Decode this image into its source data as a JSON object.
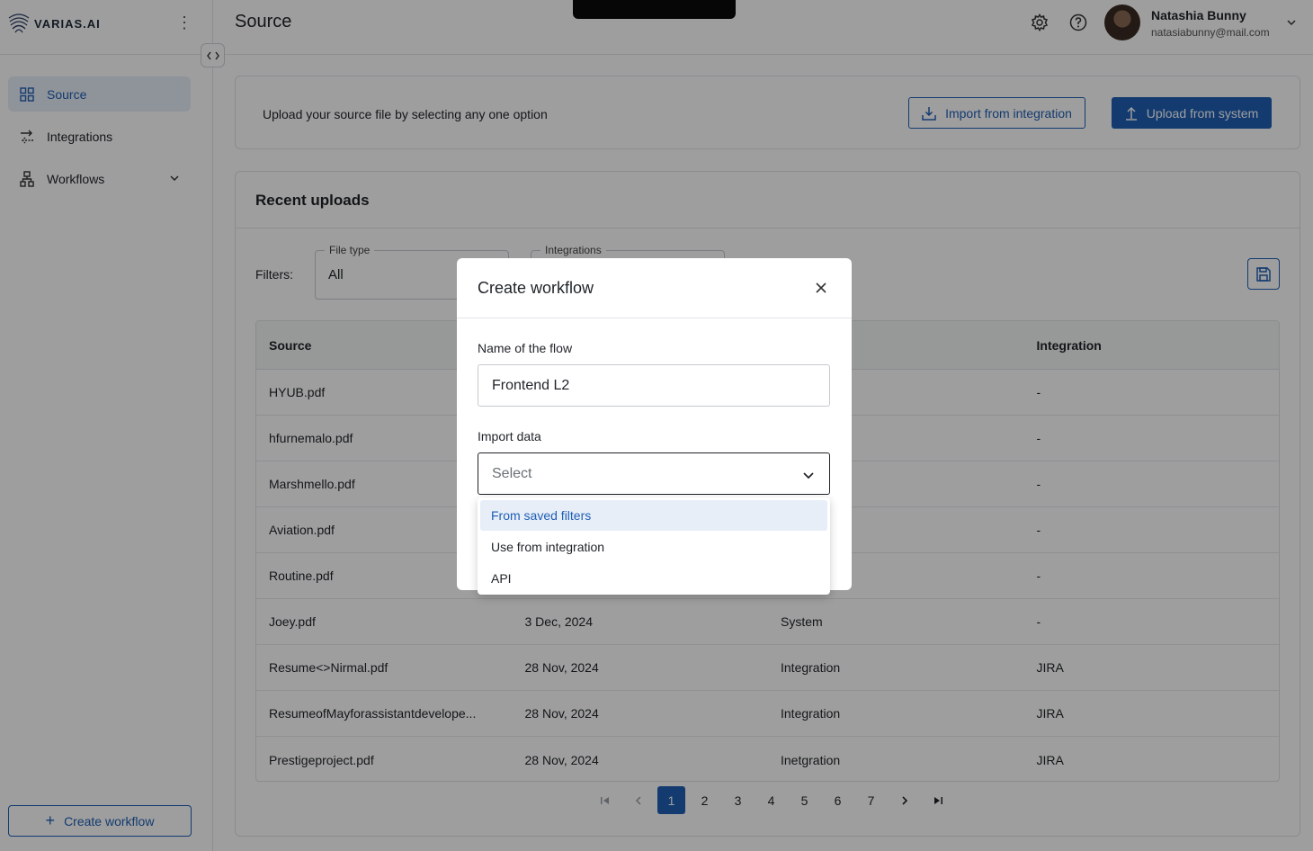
{
  "app": {
    "brand": "VARIAS.AI"
  },
  "sidebar": {
    "items": [
      {
        "label": "Source",
        "icon": "grid-icon",
        "active": true
      },
      {
        "label": "Integrations",
        "icon": "arrows-icon"
      },
      {
        "label": "Workflows",
        "icon": "workflow-icon"
      }
    ],
    "create_workflow_label": "Create workflow"
  },
  "header": {
    "title": "Source",
    "user_name": "Natashia Bunny",
    "user_email": "natasiabunny@mail.com"
  },
  "upload": {
    "prompt": "Upload your source file by selecting any one option",
    "import_label": "Import from integration",
    "upload_label": "Upload from system"
  },
  "recent": {
    "title": "Recent uploads",
    "filters_label": "Filters:",
    "file_type": {
      "legend": "File type",
      "value": "All"
    },
    "integrations": {
      "legend": "Integrations"
    },
    "columns": [
      "Source",
      "",
      "",
      "Integration"
    ],
    "rows": [
      [
        "HYUB.pdf",
        "",
        "",
        "-"
      ],
      [
        "hfurnemalo.pdf",
        "",
        "",
        "-"
      ],
      [
        "Marshmello.pdf",
        "",
        "",
        "-"
      ],
      [
        "Aviation.pdf",
        "",
        "",
        "-"
      ],
      [
        "Routine.pdf",
        "",
        "",
        "-"
      ],
      [
        "Joey.pdf",
        "3 Dec, 2024",
        "System",
        "-"
      ],
      [
        "Resume<>Nirmal.pdf",
        "28 Nov, 2024",
        "Integration",
        "JIRA"
      ],
      [
        "ResumeofMayforassistantdevelope...",
        "28 Nov, 2024",
        "Integration",
        "JIRA"
      ],
      [
        "Prestigeproject.pdf",
        "28 Nov, 2024",
        "Inetgration",
        "JIRA"
      ]
    ],
    "pages": [
      "1",
      "2",
      "3",
      "4",
      "5",
      "6",
      "7"
    ],
    "current_page": "1"
  },
  "modal": {
    "title": "Create workflow",
    "name_label": "Name of the flow",
    "name_value": "Frontend L2",
    "import_label": "Import data",
    "import_placeholder": "Select",
    "options": [
      "From saved filters",
      "Use from integration",
      "API"
    ],
    "highlighted_option": "From saved filters"
  },
  "colors": {
    "accent": "#1f5fb5",
    "overlay": "rgba(0,0,0,0.38)"
  }
}
